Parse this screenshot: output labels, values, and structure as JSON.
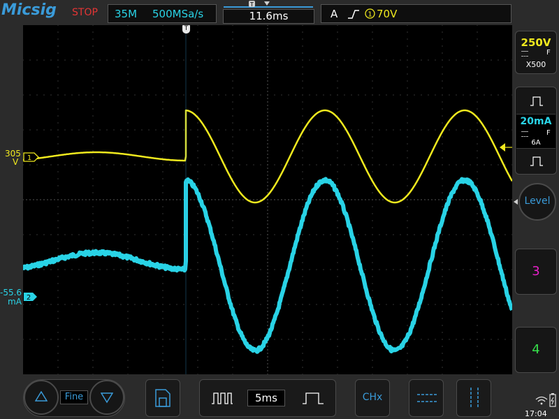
{
  "header": {
    "logo": "Micsig",
    "run_state": "STOP",
    "memory_depth": "35M",
    "sample_rate": "500MSa/s",
    "time_position": "11.6ms",
    "trigger_mode": "A",
    "trigger_channel_marker": "1",
    "trigger_level": "70V"
  },
  "channels": {
    "ch1": {
      "number": "1",
      "offset_value": "305",
      "offset_unit": "V",
      "color": "#f0e91e",
      "scale": "250V",
      "coupling_flag": "F",
      "probe": "X500"
    },
    "ch2": {
      "number": "2",
      "offset_value": "-55.6",
      "offset_unit": "mA",
      "color": "#29d3e6",
      "scale": "20mA",
      "coupling_flag": "F",
      "probe": "6A"
    }
  },
  "sidebar": {
    "level_button": "Level",
    "ch3_button": "3",
    "ch4_button": "4",
    "ch3_color": "#e61fc8",
    "ch4_color": "#35e04a"
  },
  "bottombar": {
    "fine_label": "Fine",
    "timebase": "5ms",
    "chx_label": "CHx"
  },
  "status": {
    "clock": "17:04"
  },
  "trigger_marker": "T",
  "icons": [
    "up-arrow-icon",
    "down-arrow-icon",
    "save-file-icon",
    "wide-pulse-icon",
    "narrow-pulse-icon",
    "cursor-horizontal-icon",
    "cursor-vertical-icon",
    "wifi-icon",
    "battery-icon"
  ]
}
